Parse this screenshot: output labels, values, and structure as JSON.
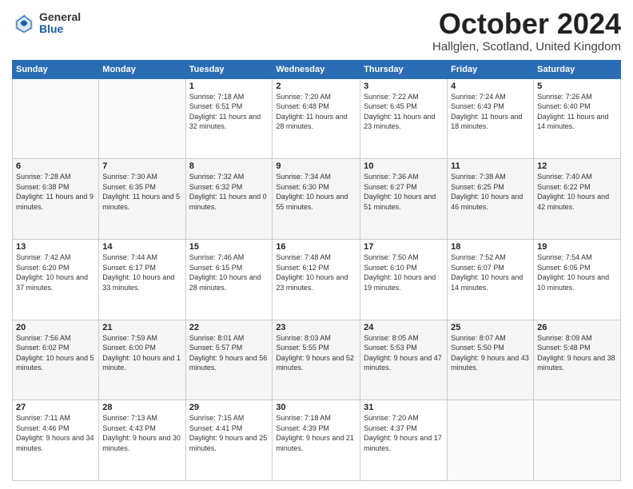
{
  "logo": {
    "general": "General",
    "blue": "Blue"
  },
  "title": "October 2024",
  "location": "Hallglen, Scotland, United Kingdom",
  "headers": [
    "Sunday",
    "Monday",
    "Tuesday",
    "Wednesday",
    "Thursday",
    "Friday",
    "Saturday"
  ],
  "weeks": [
    [
      {
        "day": "",
        "sunrise": "",
        "sunset": "",
        "daylight": ""
      },
      {
        "day": "",
        "sunrise": "",
        "sunset": "",
        "daylight": ""
      },
      {
        "day": "1",
        "sunrise": "Sunrise: 7:18 AM",
        "sunset": "Sunset: 6:51 PM",
        "daylight": "Daylight: 11 hours and 32 minutes."
      },
      {
        "day": "2",
        "sunrise": "Sunrise: 7:20 AM",
        "sunset": "Sunset: 6:48 PM",
        "daylight": "Daylight: 11 hours and 28 minutes."
      },
      {
        "day": "3",
        "sunrise": "Sunrise: 7:22 AM",
        "sunset": "Sunset: 6:45 PM",
        "daylight": "Daylight: 11 hours and 23 minutes."
      },
      {
        "day": "4",
        "sunrise": "Sunrise: 7:24 AM",
        "sunset": "Sunset: 6:43 PM",
        "daylight": "Daylight: 11 hours and 18 minutes."
      },
      {
        "day": "5",
        "sunrise": "Sunrise: 7:26 AM",
        "sunset": "Sunset: 6:40 PM",
        "daylight": "Daylight: 11 hours and 14 minutes."
      }
    ],
    [
      {
        "day": "6",
        "sunrise": "Sunrise: 7:28 AM",
        "sunset": "Sunset: 6:38 PM",
        "daylight": "Daylight: 11 hours and 9 minutes."
      },
      {
        "day": "7",
        "sunrise": "Sunrise: 7:30 AM",
        "sunset": "Sunset: 6:35 PM",
        "daylight": "Daylight: 11 hours and 5 minutes."
      },
      {
        "day": "8",
        "sunrise": "Sunrise: 7:32 AM",
        "sunset": "Sunset: 6:32 PM",
        "daylight": "Daylight: 11 hours and 0 minutes."
      },
      {
        "day": "9",
        "sunrise": "Sunrise: 7:34 AM",
        "sunset": "Sunset: 6:30 PM",
        "daylight": "Daylight: 10 hours and 55 minutes."
      },
      {
        "day": "10",
        "sunrise": "Sunrise: 7:36 AM",
        "sunset": "Sunset: 6:27 PM",
        "daylight": "Daylight: 10 hours and 51 minutes."
      },
      {
        "day": "11",
        "sunrise": "Sunrise: 7:38 AM",
        "sunset": "Sunset: 6:25 PM",
        "daylight": "Daylight: 10 hours and 46 minutes."
      },
      {
        "day": "12",
        "sunrise": "Sunrise: 7:40 AM",
        "sunset": "Sunset: 6:22 PM",
        "daylight": "Daylight: 10 hours and 42 minutes."
      }
    ],
    [
      {
        "day": "13",
        "sunrise": "Sunrise: 7:42 AM",
        "sunset": "Sunset: 6:20 PM",
        "daylight": "Daylight: 10 hours and 37 minutes."
      },
      {
        "day": "14",
        "sunrise": "Sunrise: 7:44 AM",
        "sunset": "Sunset: 6:17 PM",
        "daylight": "Daylight: 10 hours and 33 minutes."
      },
      {
        "day": "15",
        "sunrise": "Sunrise: 7:46 AM",
        "sunset": "Sunset: 6:15 PM",
        "daylight": "Daylight: 10 hours and 28 minutes."
      },
      {
        "day": "16",
        "sunrise": "Sunrise: 7:48 AM",
        "sunset": "Sunset: 6:12 PM",
        "daylight": "Daylight: 10 hours and 23 minutes."
      },
      {
        "day": "17",
        "sunrise": "Sunrise: 7:50 AM",
        "sunset": "Sunset: 6:10 PM",
        "daylight": "Daylight: 10 hours and 19 minutes."
      },
      {
        "day": "18",
        "sunrise": "Sunrise: 7:52 AM",
        "sunset": "Sunset: 6:07 PM",
        "daylight": "Daylight: 10 hours and 14 minutes."
      },
      {
        "day": "19",
        "sunrise": "Sunrise: 7:54 AM",
        "sunset": "Sunset: 6:05 PM",
        "daylight": "Daylight: 10 hours and 10 minutes."
      }
    ],
    [
      {
        "day": "20",
        "sunrise": "Sunrise: 7:56 AM",
        "sunset": "Sunset: 6:02 PM",
        "daylight": "Daylight: 10 hours and 5 minutes."
      },
      {
        "day": "21",
        "sunrise": "Sunrise: 7:59 AM",
        "sunset": "Sunset: 6:00 PM",
        "daylight": "Daylight: 10 hours and 1 minute."
      },
      {
        "day": "22",
        "sunrise": "Sunrise: 8:01 AM",
        "sunset": "Sunset: 5:57 PM",
        "daylight": "Daylight: 9 hours and 56 minutes."
      },
      {
        "day": "23",
        "sunrise": "Sunrise: 8:03 AM",
        "sunset": "Sunset: 5:55 PM",
        "daylight": "Daylight: 9 hours and 52 minutes."
      },
      {
        "day": "24",
        "sunrise": "Sunrise: 8:05 AM",
        "sunset": "Sunset: 5:53 PM",
        "daylight": "Daylight: 9 hours and 47 minutes."
      },
      {
        "day": "25",
        "sunrise": "Sunrise: 8:07 AM",
        "sunset": "Sunset: 5:50 PM",
        "daylight": "Daylight: 9 hours and 43 minutes."
      },
      {
        "day": "26",
        "sunrise": "Sunrise: 8:09 AM",
        "sunset": "Sunset: 5:48 PM",
        "daylight": "Daylight: 9 hours and 38 minutes."
      }
    ],
    [
      {
        "day": "27",
        "sunrise": "Sunrise: 7:11 AM",
        "sunset": "Sunset: 4:46 PM",
        "daylight": "Daylight: 9 hours and 34 minutes."
      },
      {
        "day": "28",
        "sunrise": "Sunrise: 7:13 AM",
        "sunset": "Sunset: 4:43 PM",
        "daylight": "Daylight: 9 hours and 30 minutes."
      },
      {
        "day": "29",
        "sunrise": "Sunrise: 7:15 AM",
        "sunset": "Sunset: 4:41 PM",
        "daylight": "Daylight: 9 hours and 25 minutes."
      },
      {
        "day": "30",
        "sunrise": "Sunrise: 7:18 AM",
        "sunset": "Sunset: 4:39 PM",
        "daylight": "Daylight: 9 hours and 21 minutes."
      },
      {
        "day": "31",
        "sunrise": "Sunrise: 7:20 AM",
        "sunset": "Sunset: 4:37 PM",
        "daylight": "Daylight: 9 hours and 17 minutes."
      },
      {
        "day": "",
        "sunrise": "",
        "sunset": "",
        "daylight": ""
      },
      {
        "day": "",
        "sunrise": "",
        "sunset": "",
        "daylight": ""
      }
    ]
  ]
}
